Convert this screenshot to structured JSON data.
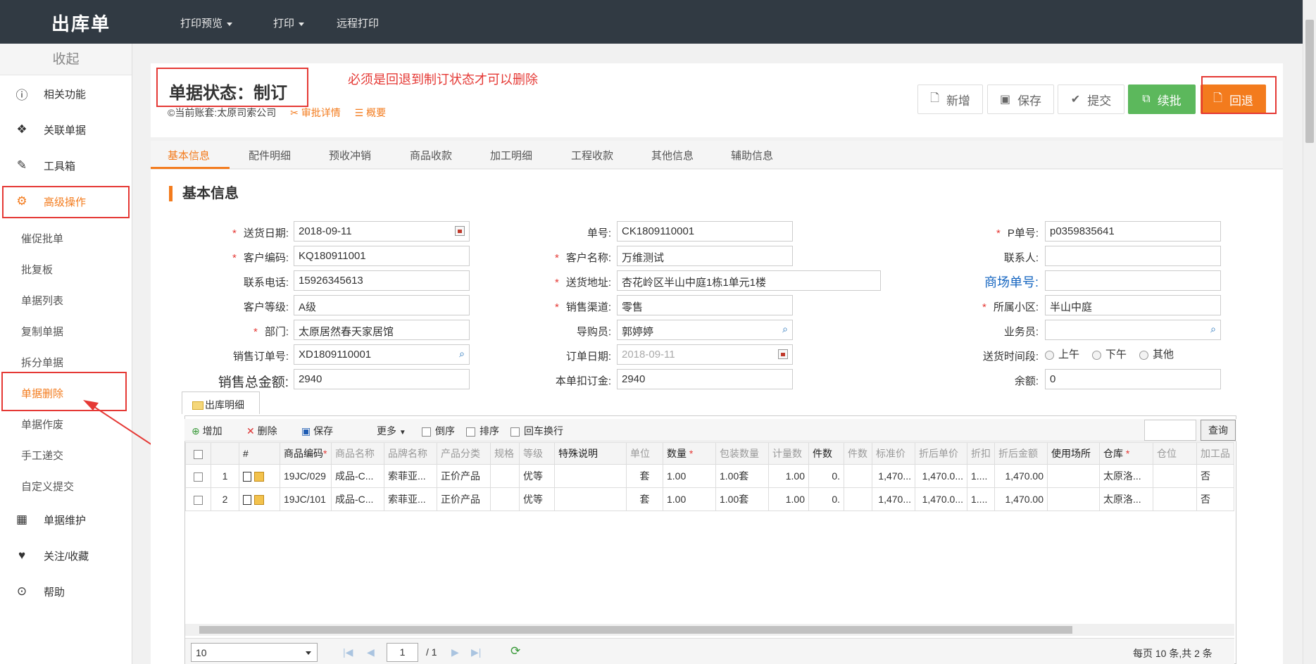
{
  "header": {
    "title": "出库单",
    "menus": [
      "打印预览",
      "打印",
      "远程打印"
    ]
  },
  "sidebar": {
    "collapse_label": "收起",
    "items": [
      {
        "label": "相关功能",
        "icon": "info-icon"
      },
      {
        "label": "关联单据",
        "icon": "dropbox-icon"
      },
      {
        "label": "工具箱",
        "icon": "wrench-icon"
      },
      {
        "label": "高级操作",
        "icon": "gears-icon"
      },
      {
        "label": "单据维护",
        "icon": "grid-icon"
      },
      {
        "label": "关注/收藏",
        "icon": "heart-icon"
      },
      {
        "label": "帮助",
        "icon": "play-circle-icon"
      }
    ],
    "sub_items": [
      "催促批单",
      "批复板",
      "单据列表",
      "复制单据",
      "拆分单据",
      "单据删除",
      "单据作废",
      "手工递交",
      "自定义提交"
    ]
  },
  "doc": {
    "status": "单据状态：制订",
    "note": "必须是回退到制订状态才可以删除",
    "account": "©当前账套:太原司索公司",
    "approval_link": "审批详情",
    "summary_link": "概要"
  },
  "actions": {
    "new": "新增",
    "save": "保存",
    "submit": "提交",
    "continue": "续批",
    "rollback": "回退"
  },
  "tabs": [
    "基本信息",
    "配件明细",
    "预收冲销",
    "商品收款",
    "加工明细",
    "工程收款",
    "其他信息",
    "辅助信息"
  ],
  "section_title": "基本信息",
  "form": {
    "delivery_date_label": "送货日期:",
    "delivery_date": "2018-09-11",
    "order_no_label": "单号:",
    "order_no": "CK1809110001",
    "p_no_label": "P单号:",
    "p_no": "p0359835641",
    "customer_code_label": "客户编码:",
    "customer_code": "KQ180911001",
    "customer_name_label": "客户名称:",
    "customer_name": "万维测试",
    "contact_label": "联系人:",
    "contact": "",
    "phone_label": "联系电话:",
    "phone": "15926345613",
    "address_label": "送货地址:",
    "address": "杏花岭区半山中庭1栋1单元1楼",
    "mall_no_label": "商场单号:",
    "mall_no": "",
    "customer_level_label": "客户等级:",
    "customer_level": "A级",
    "channel_label": "销售渠道:",
    "channel": "零售",
    "community_label": "所属小区:",
    "community": "半山中庭",
    "dept_label": "部门:",
    "dept": "太原居然春天家居馆",
    "guide_label": "导购员:",
    "guide": "郭婷婷",
    "salesman_label": "业务员:",
    "salesman": "",
    "sales_order_label": "销售订单号:",
    "sales_order": "XD1809110001",
    "order_date_label": "订单日期:",
    "order_date": "2018-09-11",
    "time_slot_label": "送货时间段:",
    "time_slots": [
      "上午",
      "下午",
      "其他"
    ],
    "total_label": "销售总金额:",
    "total": "2940",
    "deposit_label": "本单扣订金:",
    "deposit": "2940",
    "balance_label": "余额:",
    "balance": "0"
  },
  "detail": {
    "subtab": "出库明细",
    "toolbar": {
      "add": "增加",
      "delete": "删除",
      "save": "保存",
      "more": "更多",
      "reverse": "倒序",
      "sort": "排序",
      "enter_wrap": "回车换行",
      "query": "查询"
    },
    "columns": [
      "#",
      "商品编码",
      "商品名称",
      "品牌名称",
      "产品分类",
      "规格",
      "等级",
      "特殊说明",
      "单位",
      "数量",
      "包装数量",
      "计量数",
      "件数",
      "件数",
      "标准价",
      "折后单价",
      "折扣",
      "折后金额",
      "使用场所",
      "仓库",
      "仓位",
      "加工品"
    ],
    "rows": [
      {
        "no": "1",
        "code": "19JC/029",
        "name": "成品-C...",
        "brand": "索菲亚...",
        "category": "正价产品",
        "spec": "",
        "grade": "优等",
        "special": "",
        "unit": "套",
        "qty": "1.00",
        "pack": "1.00套",
        "measure": "1.00",
        "pieces": "0.",
        "pieces2": "",
        "std_price": "1,470...",
        "disc_price": "1,470.0...",
        "discount": "1....",
        "amount": "1,470.00",
        "place": "",
        "warehouse": "太原洛...",
        "bin": "",
        "processed": "否"
      },
      {
        "no": "2",
        "code": "19JC/101",
        "name": "成品-C...",
        "brand": "索菲亚...",
        "category": "正价产品",
        "spec": "",
        "grade": "优等",
        "special": "",
        "unit": "套",
        "qty": "1.00",
        "pack": "1.00套",
        "measure": "1.00",
        "pieces": "0.",
        "pieces2": "",
        "std_price": "1,470...",
        "disc_price": "1,470.0...",
        "discount": "1....",
        "amount": "1,470.00",
        "place": "",
        "warehouse": "太原洛...",
        "bin": "",
        "processed": "否"
      }
    ],
    "pager": {
      "page_size": "10",
      "page": "1",
      "total_pages": "/ 1",
      "summary": "每页 10 条,共 2 条"
    }
  },
  "colors": {
    "accent": "#f37b1d",
    "topbar": "#313a43",
    "alert": "#e53935",
    "green": "#5cb85c"
  }
}
